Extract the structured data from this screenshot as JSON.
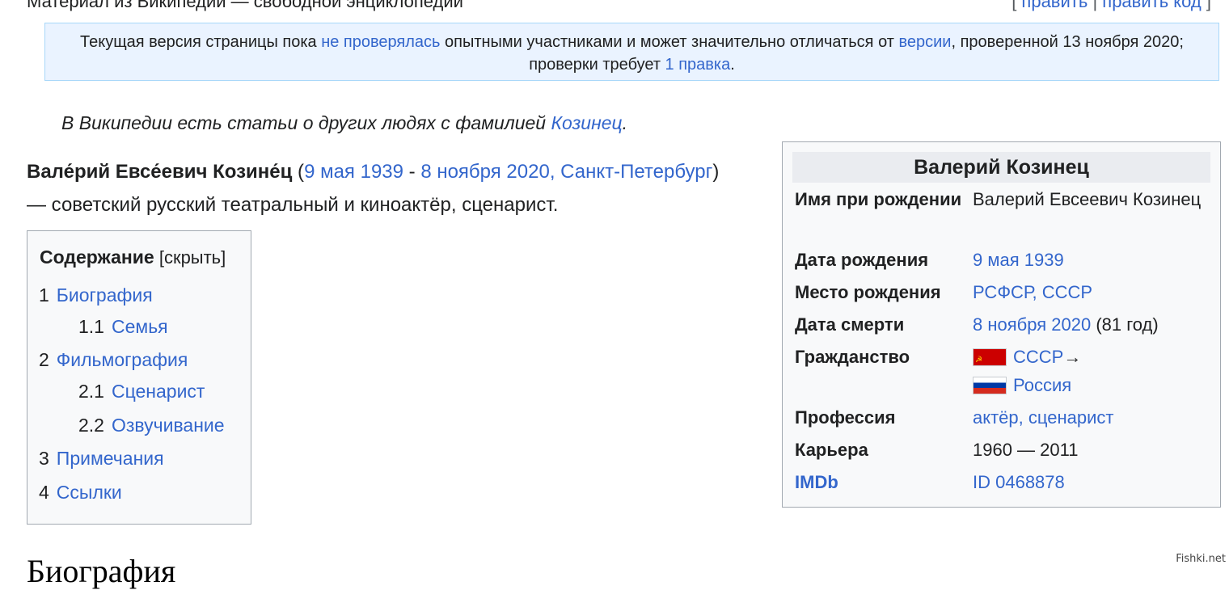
{
  "header": {
    "site_sub": "Материал из Википедии — свободной энциклопедии",
    "edit_open": "[ ",
    "edit": "править",
    "sep": " | ",
    "edit_source": "править код",
    "edit_close": " ]"
  },
  "notice": {
    "t1": "Текущая версия страницы пока ",
    "l1": "не проверялась",
    "t2": " опытными участниками и может значительно отличаться от ",
    "l2": "версии",
    "t3": ", проверенной 13 ноября 2020; проверки требует ",
    "l3": "1 правка",
    "t4": "."
  },
  "hatnote": {
    "text": "В Википедии есть статьи о других людях с фамилией ",
    "link": "Козинец",
    "end": "."
  },
  "lead": {
    "name": "Вале́рий Евсе́евич Козине́ц",
    "open": " (",
    "birth": "9 мая 1939",
    "dash": " - ",
    "death": "8 ноября 2020",
    "comma": ", ",
    "place": "Санкт-Петербург",
    "rest": ") — советский русский театральный и киноактёр, сценарист."
  },
  "toc": {
    "title": "Содержание",
    "toggle_open": " [",
    "toggle": "скрыть",
    "toggle_close": "]",
    "items": [
      {
        "num": "1",
        "label": "Биография"
      },
      {
        "num": "1.1",
        "label": "Семья"
      },
      {
        "num": "2",
        "label": "Фильмография"
      },
      {
        "num": "2.1",
        "label": "Сценарист"
      },
      {
        "num": "2.2",
        "label": "Озвучивание"
      },
      {
        "num": "3",
        "label": "Примечания"
      },
      {
        "num": "4",
        "label": "Ссылки"
      }
    ]
  },
  "infobox": {
    "title": "Валерий Козинец",
    "birth_name_label": "Имя при рождении",
    "birth_name_value": "Валерий Евсеевич Козинец",
    "birth_date_label": "Дата рождения",
    "birth_date_value": "9 мая 1939",
    "birth_place_label": "Место рождения",
    "birth_place_1": "РСФСР",
    "birth_place_comma": ", ",
    "birth_place_2": "СССР",
    "death_date_label": "Дата смерти",
    "death_date_value": "8 ноября 2020",
    "death_age": " (81 год)",
    "citizenship_label": "Гражданство",
    "citizenship_1": "СССР",
    "citizenship_arrow": "→",
    "citizenship_2": "Россия",
    "profession_label": "Профессия",
    "profession_1": "актёр",
    "profession_comma": ", ",
    "profession_2": "сценарист",
    "career_label": "Карьера",
    "career_value": "1960 — 2011",
    "imdb_label": "IMDb",
    "imdb_value": "ID 0468878",
    "colors": {
      "flag_ussr": "#cc0000",
      "flag_ru": [
        "#ffffff",
        "#0039a6",
        "#d52b1e"
      ]
    }
  },
  "next_heading": "Биография",
  "watermark": "Fishki.net",
  "colors": {
    "link": "#3366cc",
    "notice_bg": "#eaf3ff",
    "box_bg": "#f8f9fa"
  }
}
